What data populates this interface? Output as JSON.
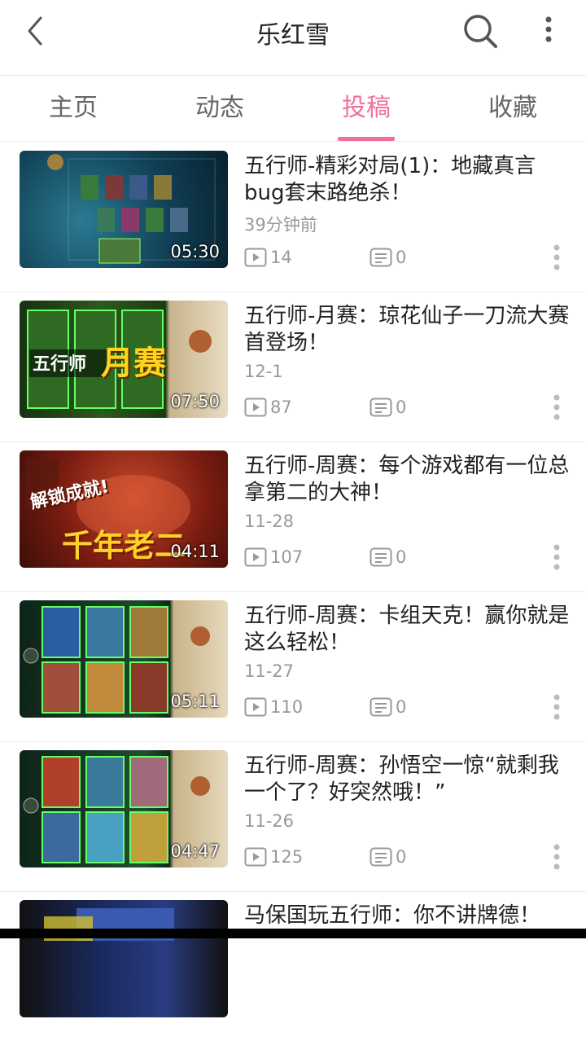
{
  "header": {
    "title": "乐红雪",
    "back_icon": "back-arrow-icon",
    "search_icon": "search-icon",
    "more_icon": "more-vertical-icon"
  },
  "tabs": [
    {
      "label": "主页",
      "active": false
    },
    {
      "label": "动态",
      "active": false
    },
    {
      "label": "投稿",
      "active": true
    },
    {
      "label": "收藏",
      "active": false
    }
  ],
  "colors": {
    "accent": "#f0709a",
    "text_primary": "#222222",
    "text_secondary": "#999999",
    "divider": "#ececec"
  },
  "videos": [
    {
      "title": "五行师-精彩对局(1)：地藏真言bug套末路绝杀！",
      "date": "39分钟前",
      "duration": "05:30",
      "plays": "14",
      "comments": "0"
    },
    {
      "title": "五行师-月赛：琼花仙子一刀流大赛首登场！",
      "date": "12-1",
      "duration": "07:50",
      "plays": "87",
      "comments": "0",
      "thumb_text": [
        "五行师",
        "月赛"
      ]
    },
    {
      "title": "五行师-周赛：每个游戏都有一位总拿第二的大神！",
      "date": "11-28",
      "duration": "04:11",
      "plays": "107",
      "comments": "0",
      "thumb_text": [
        "解锁成就!",
        "千年老二"
      ]
    },
    {
      "title": "五行师-周赛：卡组天克！赢你就是这么轻松！",
      "date": "11-27",
      "duration": "05:11",
      "plays": "110",
      "comments": "0"
    },
    {
      "title": "五行师-周赛：孙悟空一惊“就剩我一个了？好突然哦！”",
      "date": "11-26",
      "duration": "04:47",
      "plays": "125",
      "comments": "0"
    },
    {
      "title": "马保国玩五行师：你不讲牌德！",
      "date": "",
      "duration": "",
      "plays": "",
      "comments": ""
    }
  ]
}
